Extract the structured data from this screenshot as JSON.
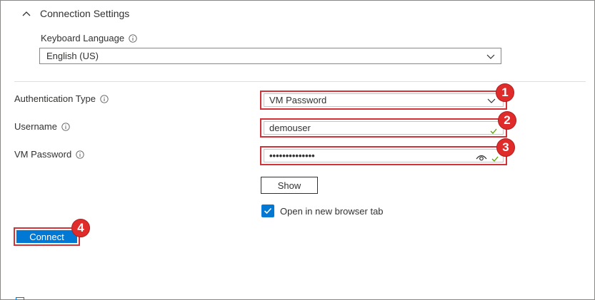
{
  "section": {
    "title": "Connection Settings"
  },
  "keyboard": {
    "label": "Keyboard Language",
    "value": "English (US)"
  },
  "auth": {
    "label": "Authentication Type",
    "value": "VM Password"
  },
  "username": {
    "label": "Username",
    "value": "demouser"
  },
  "password": {
    "label": "VM Password",
    "value": "••••••••••••••"
  },
  "show_button": {
    "label": "Show"
  },
  "new_tab": {
    "label": "Open in new browser tab",
    "checked": true
  },
  "connect_button": {
    "label": "Connect"
  },
  "badges": [
    "1",
    "2",
    "3",
    "4"
  ],
  "colors": {
    "accent": "#0078d4",
    "highlight": "#d13438",
    "badge": "#e02b2b",
    "valid": "#57a300"
  },
  "icons": [
    "chevron-up-icon",
    "info-icon",
    "chevron-down-icon",
    "checkmark-icon",
    "eye-icon"
  ]
}
